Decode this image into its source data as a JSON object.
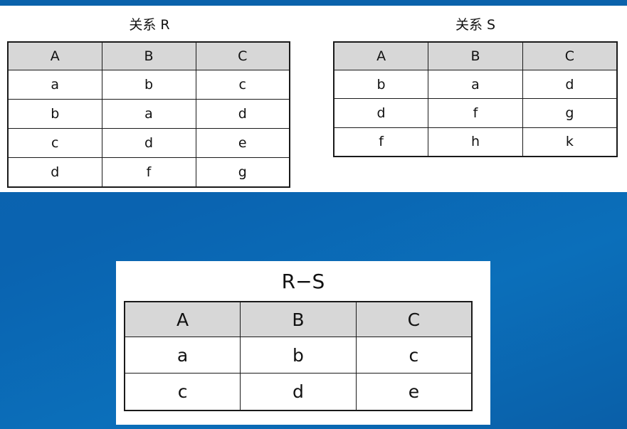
{
  "relation_r": {
    "title": "关系 R",
    "columns": [
      "A",
      "B",
      "C"
    ],
    "rows": [
      [
        "a",
        "b",
        "c"
      ],
      [
        "b",
        "a",
        "d"
      ],
      [
        "c",
        "d",
        "e"
      ],
      [
        "d",
        "f",
        "g"
      ]
    ]
  },
  "relation_s": {
    "title": "关系 S",
    "columns": [
      "A",
      "B",
      "C"
    ],
    "rows": [
      [
        "b",
        "a",
        "d"
      ],
      [
        "d",
        "f",
        "g"
      ],
      [
        "f",
        "h",
        "k"
      ]
    ]
  },
  "result": {
    "title": "R−S",
    "columns": [
      "A",
      "B",
      "C"
    ],
    "rows": [
      [
        "a",
        "b",
        "c"
      ],
      [
        "c",
        "d",
        "e"
      ]
    ]
  },
  "colors": {
    "background": "#0b66b2",
    "header_fill": "#d7d7d7",
    "border": "#1a1a1a"
  }
}
